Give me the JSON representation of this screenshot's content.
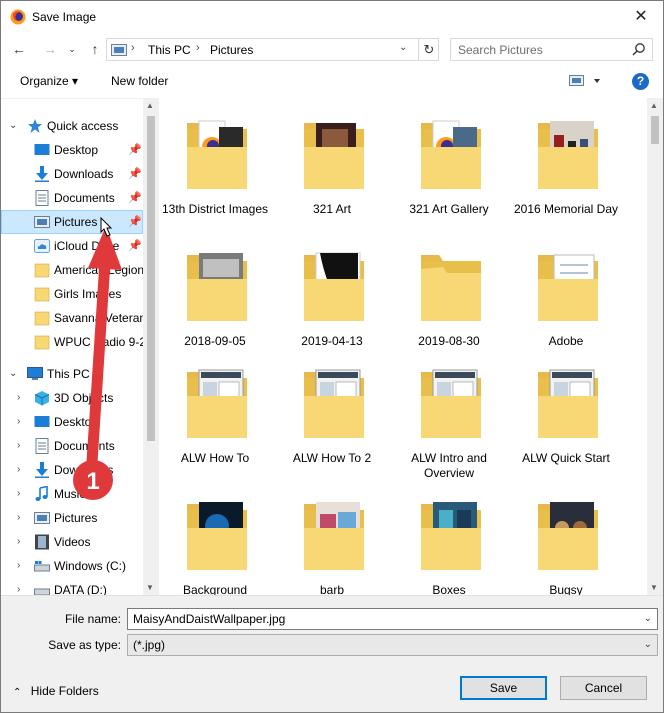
{
  "window": {
    "title": "Save Image"
  },
  "address": {
    "crumbs": [
      "This PC",
      "Pictures"
    ]
  },
  "search": {
    "placeholder": "Search Pictures"
  },
  "toolbar": {
    "organize_label": "Organize ▾",
    "new_folder_label": "New folder",
    "help_label": "?"
  },
  "nav": {
    "quick_access": "Quick access",
    "quick": [
      "Desktop",
      "Downloads",
      "Documents",
      "Pictures",
      "iCloud Drive",
      "American Legion",
      "Girls Images",
      "Savanna Veteran",
      "WPUC Radio 9-2"
    ],
    "this_pc": "This PC",
    "pc": [
      "3D Objects",
      "Desktop",
      "Documents",
      "Downloads",
      "Music",
      "Pictures",
      "Videos",
      "Windows (C:)",
      "DATA (D:)"
    ]
  },
  "folders": [
    {
      "name": "13th District Images",
      "thumb": "firefox"
    },
    {
      "name": "321 Art",
      "thumb": "art"
    },
    {
      "name": "321 Art Gallery",
      "thumb": "firefox2"
    },
    {
      "name": "2016 Memorial Day",
      "thumb": "memorial"
    },
    {
      "name": "2018-09-05",
      "thumb": "bw"
    },
    {
      "name": "2019-04-13",
      "thumb": "black"
    },
    {
      "name": "2019-08-30",
      "thumb": "empty"
    },
    {
      "name": "Adobe",
      "thumb": "doc"
    },
    {
      "name": "ALW How To",
      "thumb": "screen"
    },
    {
      "name": "ALW How To 2",
      "thumb": "screen"
    },
    {
      "name": "ALW Intro and Overview",
      "thumb": "screen"
    },
    {
      "name": "ALW Quick Start",
      "thumb": "screen"
    },
    {
      "name": "Background",
      "thumb": "blue"
    },
    {
      "name": "barb",
      "thumb": "barb"
    },
    {
      "name": "Boxes",
      "thumb": "boxes"
    },
    {
      "name": "Bugsy",
      "thumb": "dogs"
    }
  ],
  "form": {
    "file_name_label": "File name:",
    "file_name_value": "MaisyAndDaistWallpaper.jpg",
    "save_type_label": "Save as type:",
    "save_type_value": "(*.jpg)"
  },
  "footer": {
    "hide_folders": "Hide Folders",
    "save": "Save",
    "cancel": "Cancel"
  },
  "annotation": {
    "number": "1"
  },
  "colors": {
    "accent": "#0078d7",
    "selection": "#cce8ff",
    "folder": "#f8d775",
    "annotation": "#e0393b"
  }
}
